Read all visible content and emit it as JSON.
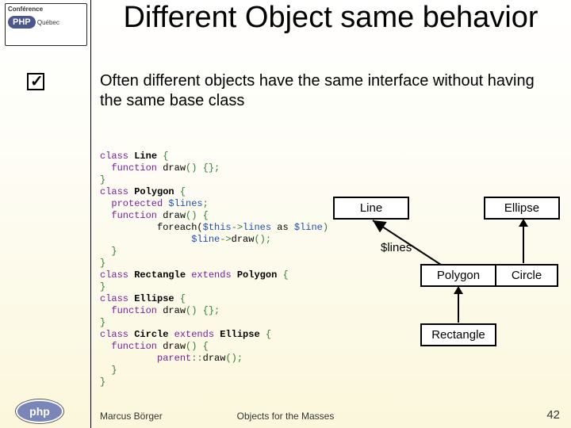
{
  "slide": {
    "title": "Different Object same behavior",
    "subtitle": "Often different objects have the same interface without having the same base class"
  },
  "conf_logo": {
    "line1": "Conférence",
    "badge": "PHP",
    "line2": "Québec"
  },
  "code": {
    "l01_a": "class",
    "l01_b": " Line ",
    "l01_c": "{",
    "l02_a": "  function ",
    "l02_b": "draw",
    "l02_c": "() {};",
    "l03_a": "}",
    "l04_a": "class",
    "l04_b": " Polygon ",
    "l04_c": "{",
    "l05_a": "  protected ",
    "l05_b": "$lines",
    "l05_c": ";",
    "l06_a": "  function ",
    "l06_b": "draw",
    "l06_c": "() {",
    "l07_a": "          foreach(",
    "l07_b": "$this",
    "l07_c": "->",
    "l07_d": "lines",
    "l07_e": " as ",
    "l07_f": "$line",
    "l07_g": ")",
    "l08_a": "                ",
    "l08_b": "$line",
    "l08_c": "->",
    "l08_d": "draw",
    "l08_e": "();",
    "l09_a": "  }",
    "l10_a": "}",
    "l11_a": "class",
    "l11_b": " Rectangle ",
    "l11_c": "extends",
    "l11_d": " Polygon ",
    "l11_e": "{",
    "l12_a": "}",
    "l13_a": "class",
    "l13_b": " Ellipse ",
    "l13_c": "{",
    "l14_a": "  function ",
    "l14_b": "draw",
    "l14_c": "() {};",
    "l15_a": "}",
    "l16_a": "class",
    "l16_b": " Circle ",
    "l16_c": "extends",
    "l16_d": " Ellipse ",
    "l16_e": "{",
    "l17_a": "  function ",
    "l17_b": "draw",
    "l17_c": "() {",
    "l18_a": "          ",
    "l18_b": "parent",
    "l18_c": "::",
    "l18_d": "draw",
    "l18_e": "();",
    "l19_a": "  }",
    "l20_a": "}"
  },
  "diagram": {
    "line": "Line",
    "ellipse": "Ellipse",
    "polygon": "Polygon",
    "circle": "Circle",
    "rectangle": "Rectangle",
    "lines_label": "$lines"
  },
  "footer": {
    "author": "Marcus Börger",
    "center": "Objects for the Masses",
    "page": "42",
    "footer_logo": "php"
  }
}
